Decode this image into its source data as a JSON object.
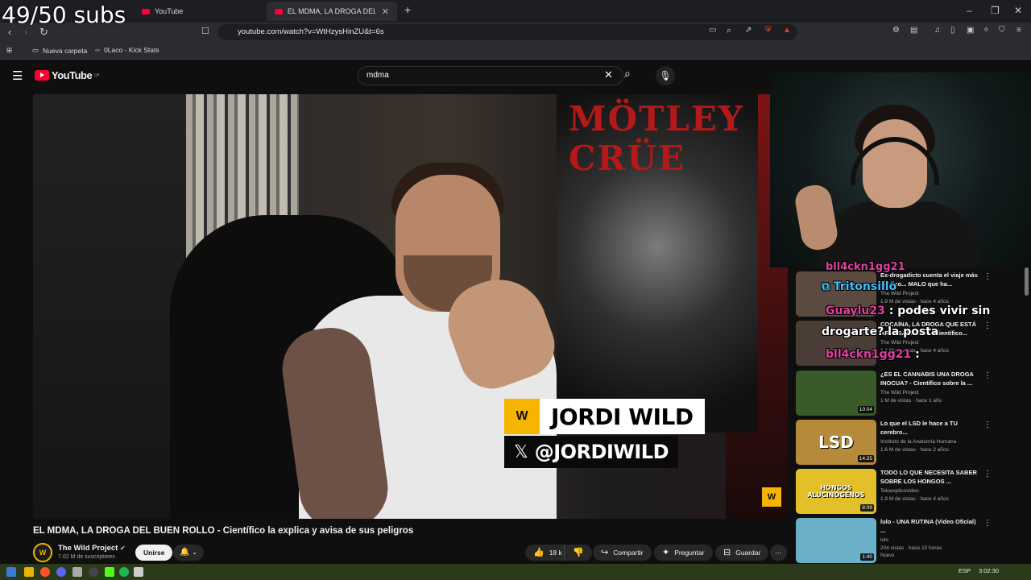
{
  "overlay": {
    "subs": "49/50 subs"
  },
  "browser": {
    "tabs": [
      {
        "label": "YouTube"
      },
      {
        "label": "EL MDMA, LA DROGA DEL BUEN"
      }
    ],
    "url": "youtube.com/watch?v=WtHzysHinZU&t=6s",
    "bookmarks": [
      "Nueva carpeta",
      "0Laco - Kick Stats"
    ]
  },
  "youtube": {
    "search_value": "mdma",
    "region": "UY"
  },
  "video": {
    "poster_text": "MÖTLEY CRÜE",
    "lower_third_name": "JORDI WILD",
    "lower_third_handle": "@JORDIWILD",
    "title": "EL MDMA, LA DROGA DEL BUEN ROLLO - Científico la explica y avisa de sus peligros",
    "channel": "The Wild Project",
    "subscribers": "7.02 M de suscriptores",
    "join_label": "Unirse",
    "likes": "18 k",
    "share_label": "Compartir",
    "ask_label": "Preguntar",
    "save_label": "Guardar"
  },
  "recommendations": [
    {
      "title": "Ex-drogadicto cuenta el viaje más médico... MALO que ha...",
      "channel": "The Wild Project",
      "meta": "1.9 M de vistas · hace 4 años",
      "duration": "",
      "thumb": "#5a4a40"
    },
    {
      "title": "COCAÍNA, LA DROGA QUE ESTÁ ARRASANDO ES - Científico...",
      "channel": "The Wild Project",
      "meta": "1.1 M de vistas · hace 4 años",
      "duration": "",
      "thumb": "#4a3d36"
    },
    {
      "title": "¿ES EL CANNABIS UNA DROGA INOCUA? - Científico sobre la ...",
      "channel": "The Wild Project",
      "meta": "1 M de vistas · hace 1 año",
      "duration": "10:04",
      "thumb": "#3b5a2a"
    },
    {
      "title": "Lo que el LSD le hace a TU cerebro...",
      "channel": "Instituto de la Anatomía Humana",
      "meta": "1.6 M de vistas · hace 2 años",
      "duration": "14:25",
      "thumb": "#b58a3a",
      "thumb_text": "LSD"
    },
    {
      "title": "TODO LO QUE NECESITA SABER SOBRE LOS HONGOS ...",
      "channel": "Teloexplicovideo",
      "meta": "1.9 M de vistas · hace 4 años",
      "duration": "8:09",
      "thumb": "#e3c02a",
      "thumb_text": "HONGOS ALUCINÓGENOS"
    },
    {
      "title": "lulo - UNA RUTINA (Video Oficial) ...",
      "channel": "lulo",
      "meta": "204 vistas · hace 10 horas",
      "duration": "1:40",
      "badge": "Nuevo",
      "thumb": "#6ab0c8"
    }
  ],
  "chat": [
    {
      "user": "bll4ckn1gg21",
      "text": ""
    },
    {
      "user": "Tritonsillo",
      "text": ""
    },
    {
      "user": "Guaylu23",
      "text": ": podes vivir sin"
    },
    {
      "user": "",
      "text": "drogarte? la posta"
    },
    {
      "user": "bll4ckn1gg21",
      "text": ":"
    }
  ],
  "taskbar": {
    "lang": "ESP",
    "time": "3:02:30"
  },
  "colors": {
    "youtube_red": "#ff0033",
    "accent_gold": "#f4b400",
    "chat_name": "#e040a0",
    "chat_cyan": "#3fc0ff"
  }
}
